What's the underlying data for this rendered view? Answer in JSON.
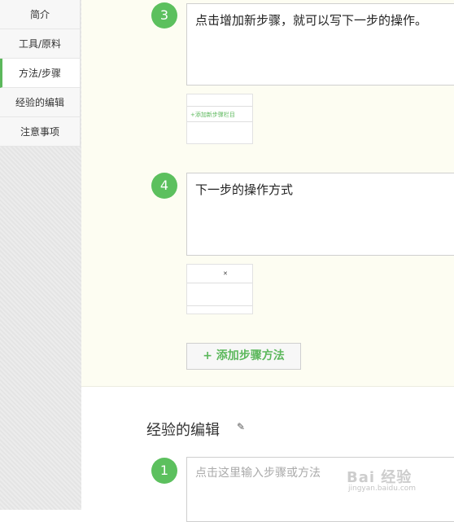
{
  "sidebar": {
    "items": [
      {
        "label": "简介"
      },
      {
        "label": "工具/原料"
      },
      {
        "label": "方法/步骤"
      },
      {
        "label": "经验的编辑"
      },
      {
        "label": "注意事项"
      }
    ],
    "active_index": 2
  },
  "steps": [
    {
      "number": "3",
      "text": "点击增加新步骤，就可以写下一步的操作。",
      "thumbnail_caption": "+添加新步骤栏目"
    },
    {
      "number": "4",
      "text": "下一步的操作方式",
      "thumbnail_caption": ""
    }
  ],
  "add_step_button": {
    "label": "+ 添加步骤方法"
  },
  "edit_section": {
    "title": "经验的编辑",
    "step_number": "1",
    "placeholder": "点击这里输入步骤或方法"
  },
  "watermark": {
    "text": "Bai 经验",
    "subtext": "jingyan.baidu.com"
  },
  "colors": {
    "accent": "#5cb85c",
    "circle": "#5cc05e",
    "cream_bg": "#fdfdf2"
  },
  "icons": {
    "pencil": "pencil-icon"
  }
}
